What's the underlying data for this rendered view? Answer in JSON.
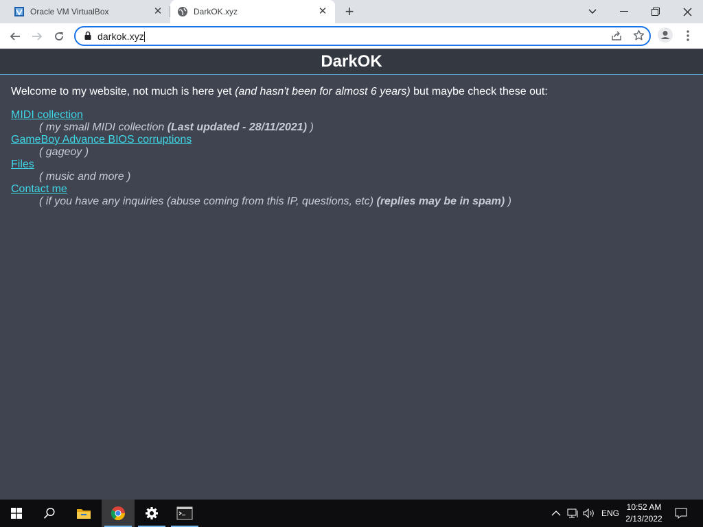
{
  "browser": {
    "tabs": [
      {
        "title": "Oracle VM VirtualBox",
        "active": false
      },
      {
        "title": "DarkOK.xyz",
        "active": true
      }
    ],
    "address": "darkok.xyz"
  },
  "page": {
    "header": "DarkOK",
    "intro": {
      "text1": "Welcome to my website, not much is here yet ",
      "italic": "(and hasn't been for almost 6 years)",
      "text2": " but maybe check these out:"
    },
    "links": [
      {
        "label": "MIDI collection",
        "desc_prefix": "( my small MIDI collection ",
        "desc_bold": "(Last updated - 28/11/2021)",
        "desc_suffix": " )"
      },
      {
        "label": "GameBoy Advance BIOS corruptions",
        "desc_prefix": "( gageoy )",
        "desc_bold": "",
        "desc_suffix": ""
      },
      {
        "label": "Files",
        "desc_prefix": "( music and more )",
        "desc_bold": "",
        "desc_suffix": ""
      },
      {
        "label": "Contact me",
        "desc_prefix": "( if you have any inquiries (abuse coming from this IP, questions, etc) ",
        "desc_bold": "(replies may be in spam)",
        "desc_suffix": " )"
      }
    ],
    "colors": {
      "background": "#3f4450",
      "header": "#343841",
      "link": "#3fd6e6",
      "accent_line": "#5aa7c9"
    }
  },
  "taskbar": {
    "apps": [
      "start-icon",
      "search-icon",
      "file-explorer-icon",
      "chrome-icon",
      "settings-icon",
      "terminal-icon"
    ],
    "language": "ENG",
    "time": "10:52 AM",
    "date": "2/13/2022"
  }
}
